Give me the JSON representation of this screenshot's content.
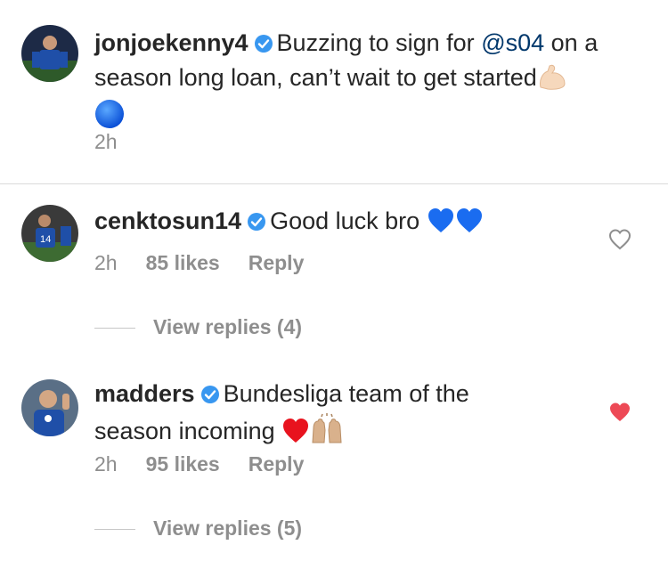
{
  "caption": {
    "username": "jonjoekenny4",
    "text_line1": "Buzzing to sign for",
    "mention": "@s04",
    "text_line1_end": "on a",
    "text_line2": "season long loan, can’t wait to get started",
    "emoji_flex": "flexed-biceps",
    "emoji_circle": "blue-circle",
    "time": "2h"
  },
  "comments": [
    {
      "username": "cenktosun14",
      "text": "Good luck bro",
      "emojis": [
        "blue-heart",
        "blue-heart"
      ],
      "time": "2h",
      "likes": "85 likes",
      "reply": "Reply",
      "view_replies": "View replies (4)",
      "liked": false
    },
    {
      "username": "madders",
      "text_line1": "Bundesliga team of the",
      "text_line2": "season incoming",
      "emojis": [
        "red-heart",
        "raising-hands"
      ],
      "time": "2h",
      "likes": "95 likes",
      "reply": "Reply",
      "view_replies": "View replies (5)",
      "liked": true
    }
  ],
  "colors": {
    "verified": "#3897f0",
    "mention": "#00376b",
    "meta": "#8e8e8e",
    "like_red": "#ed4956"
  }
}
